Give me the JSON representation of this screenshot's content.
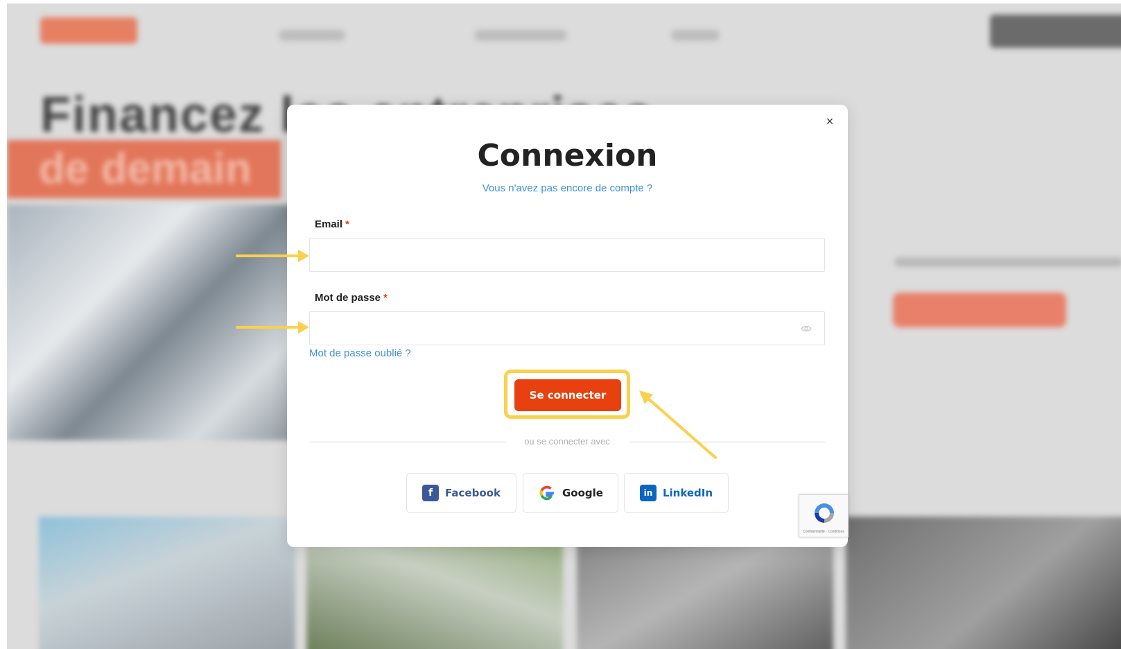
{
  "background": {
    "hero_title": "Financez les entreprises",
    "hero_band": "de demain"
  },
  "modal": {
    "close_symbol": "×",
    "title": "Connexion",
    "signup_link": "Vous n'avez pas encore de compte ?",
    "email_label": "Email",
    "email_value": "",
    "password_label": "Mot de passe",
    "password_value": "",
    "required_marker": "*",
    "forgot_password": "Mot de passe oublié ?",
    "login_button": "Se connecter",
    "divider_text": "ou se connecter avec",
    "social": [
      {
        "label": "Facebook",
        "icon": "facebook-icon",
        "color": "#3b5998"
      },
      {
        "label": "Google",
        "icon": "google-icon",
        "color": "#222222"
      },
      {
        "label": "LinkedIn",
        "icon": "linkedin-icon",
        "color": "#0a66c2"
      }
    ],
    "recaptcha_terms": "Confidentialité - Conditions"
  },
  "annotations": {
    "arrow_color": "#fbd04d",
    "highlight_target": "login-button"
  },
  "colors": {
    "accent": "#e8400f",
    "link": "#3d8fd6",
    "required": "#e0401c"
  }
}
